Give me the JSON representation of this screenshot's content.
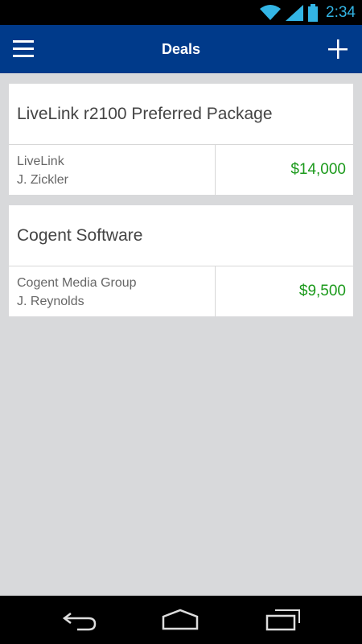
{
  "status_bar": {
    "time": "2:34",
    "icons": [
      "wifi-icon",
      "signal-icon",
      "battery-icon"
    ],
    "color": "#33b5e5"
  },
  "app_bar": {
    "title": "Deals",
    "menu_icon": "hamburger-menu-icon",
    "add_icon": "plus-icon",
    "background": "#003a8a"
  },
  "deals": [
    {
      "title": "LiveLink r2100 Preferred Package",
      "company": "LiveLink",
      "contact": "J. Zickler",
      "amount": "$14,000"
    },
    {
      "title": "Cogent Software",
      "company": "Cogent Media Group",
      "contact": "J. Reynolds",
      "amount": "$9,500"
    }
  ],
  "nav_bar": {
    "icons": [
      "back-icon",
      "home-icon",
      "recent-apps-icon"
    ]
  },
  "colors": {
    "amount": "#1c9a1c",
    "background": "#d8d9db"
  }
}
